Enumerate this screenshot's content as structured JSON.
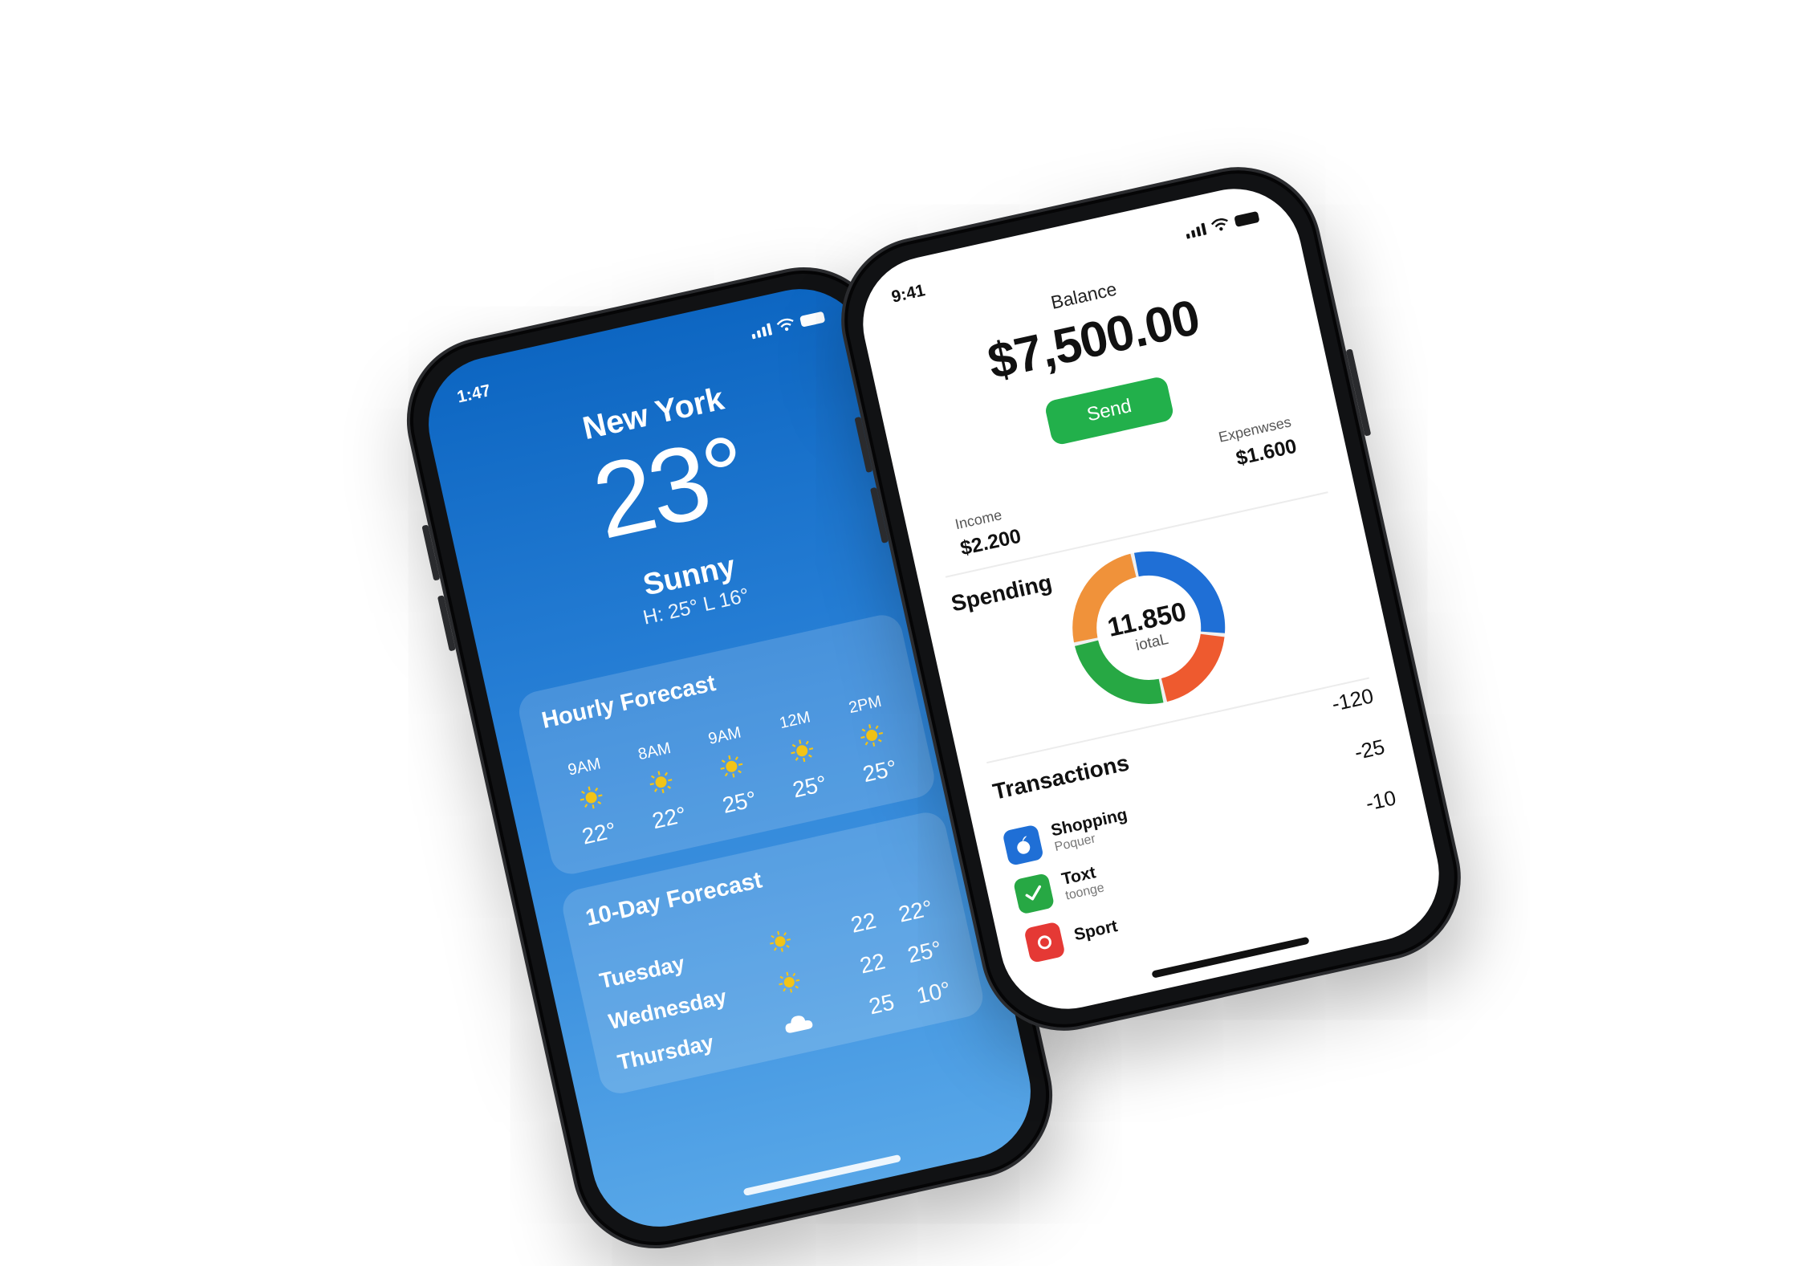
{
  "weather": {
    "status": {
      "time": "1:47"
    },
    "city": "New York",
    "temperature": "23°",
    "condition": "Sunny",
    "high_low": "H: 25° L 16°",
    "hourly_title": "Hourly Forecast",
    "hourly": [
      {
        "time": "9AM",
        "temp": "22°",
        "icon": "sun-icon"
      },
      {
        "time": "8AM",
        "temp": "22°",
        "icon": "sun-icon"
      },
      {
        "time": "9AM",
        "temp": "25°",
        "icon": "sun-icon"
      },
      {
        "time": "12M",
        "temp": "25°",
        "icon": "sun-icon"
      },
      {
        "time": "2PM",
        "temp": "25°",
        "icon": "sun-icon"
      }
    ],
    "daily_title": "10-Day Forecast",
    "daily": [
      {
        "day": "Tuesday",
        "icon": "sun-icon",
        "low": "22",
        "high": "22°"
      },
      {
        "day": "Wednesday",
        "icon": "sun-icon",
        "low": "22",
        "high": "25°"
      },
      {
        "day": "Thursday",
        "icon": "cloud-icon",
        "low": "25",
        "high": "10°"
      }
    ],
    "colors": {
      "sun": "#f2c417",
      "background_top": "#0d66c2",
      "background_bottom": "#58a7e8"
    }
  },
  "finance": {
    "status": {
      "time": "9:41"
    },
    "balance_label": "Balance",
    "balance": "$7,500.00",
    "send_label": "Send",
    "income_label": "Income",
    "income": "$2.200",
    "expenses_label": "Expenwses",
    "expenses": "$1.600",
    "spending_title": "Spending",
    "spending_total": "11.850",
    "spending_total_label": "iotaL",
    "spending_segments": [
      {
        "color": "#1f6fd6",
        "fraction": 0.3
      },
      {
        "color": "#ee5a2f",
        "fraction": 0.2
      },
      {
        "color": "#27a844",
        "fraction": 0.25
      },
      {
        "color": "#f0923a",
        "fraction": 0.25
      }
    ],
    "transactions_title": "Transactions",
    "amounts": [
      "-120",
      "-25",
      "-10"
    ],
    "transactions": [
      {
        "name": "Shopping",
        "sub": "Poquer",
        "icon": "apple-icon",
        "color": "#1f6fd6"
      },
      {
        "name": "Toxt",
        "sub": "toonge",
        "icon": "check-icon",
        "color": "#27a844"
      },
      {
        "name": "Sport",
        "sub": "",
        "icon": "sport-icon",
        "color": "#e53935"
      }
    ]
  }
}
